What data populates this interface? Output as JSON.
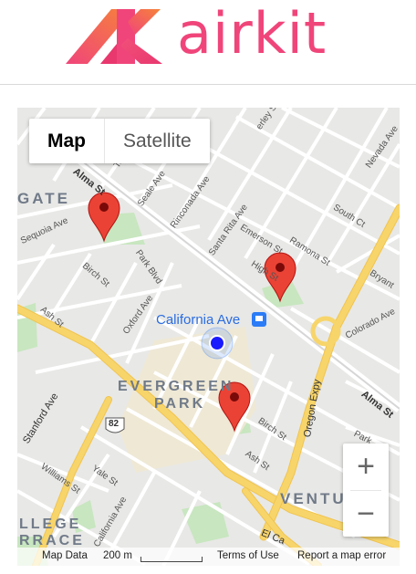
{
  "header": {
    "brand": "airkit",
    "colors": {
      "brand_pink": "#f0457a",
      "brand_orange": "#f6833a"
    }
  },
  "map": {
    "type_control": {
      "map_label": "Map",
      "satellite_label": "Satellite",
      "selected": "Map"
    },
    "zoom": {
      "in_label": "+",
      "out_label": "−"
    },
    "attribution": {
      "map_data": "Map Data",
      "scale": "200 m",
      "terms": "Terms of Use",
      "report": "Report a map error"
    },
    "places": {
      "station": "California Ave",
      "neighborhood_line1": "EVERGREEN",
      "neighborhood_line2": "PARK",
      "gate_fragment": "GATE",
      "venture_fragment": "VENTU",
      "college_line1": "LLEGE",
      "college_line2": "RRACE",
      "route_shield": "82"
    },
    "streets": {
      "alma_top": "Alma St",
      "alma_right": "Alma St",
      "seale": "Seale Ave",
      "rinconada": "Rinconada Ave",
      "santa_rita": "Santa Rita Ave",
      "emerson": "Emerson St",
      "ramona": "Ramona St",
      "high": "High St",
      "south_ct": "South Ct",
      "nevada": "Nevada Ave",
      "bryant": "Bryant",
      "colorado": "Colorado Ave",
      "oregon": "Oregon Expy",
      "sequoia": "Sequoia Ave",
      "birch_top": "Birch St",
      "park_blvd": "Park Blvd",
      "ash_top": "Ash St",
      "oxford": "Oxford Ave",
      "stanford": "Stanford Ave",
      "birch_bottom": "Birch St",
      "ash_bottom": "Ash St",
      "yale": "Yale St",
      "williams": "Williams St",
      "el_camino": "El Ca",
      "california_ave_lower": "California Ave",
      "park_right": "Park",
      "alma_right2": "Alma",
      "henley": "erley St",
      "tennyson": "Te"
    },
    "markers": [
      "marker-gate-park",
      "marker-high-st",
      "marker-evergreen-park"
    ],
    "colors": {
      "marker_red": "#ea4335",
      "location_blue": "#1a1aff",
      "highway_yellow": "#f7d56b",
      "park_green": "#c8e6c0"
    }
  }
}
